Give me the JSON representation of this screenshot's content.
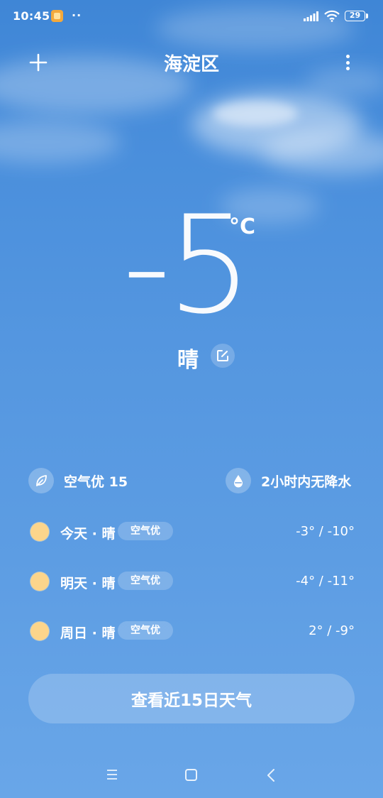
{
  "status_bar": {
    "time": "10:45",
    "more": "··",
    "battery": "29",
    "icons": [
      "app-notification-icon",
      "signal-icon",
      "wifi-icon",
      "battery-icon"
    ]
  },
  "header": {
    "title": "海淀区",
    "add_icon": "plus-icon",
    "menu_icon": "more-vertical-icon"
  },
  "current": {
    "temperature": "-5",
    "unit": "°C",
    "condition": "晴",
    "edit_icon": "edit-icon"
  },
  "info": {
    "air_quality": "空气优 15",
    "air_icon": "leaf-icon",
    "precipitation": "2小时内无降水",
    "precip_icon": "raindrop-icon"
  },
  "forecast": [
    {
      "label": "今天 · 晴",
      "badge": "空气优",
      "temps": "-3° / -10°",
      "icon": "sun-icon"
    },
    {
      "label": "明天 · 晴",
      "badge": "空气优",
      "temps": "-4° / -11°",
      "icon": "sun-icon"
    },
    {
      "label": "周日 · 晴",
      "badge": "空气优",
      "temps": "2° / -9°",
      "icon": "sun-icon"
    }
  ],
  "button_15day": "查看近15日天气",
  "nav_bar": {
    "icons": [
      "menu-icon",
      "home-icon",
      "back-icon"
    ]
  },
  "colors": {
    "sky_top": "#3f86d6",
    "sky_bottom": "#69a6e8",
    "sun": "#fcd58b",
    "notification": "#f3a93c"
  }
}
